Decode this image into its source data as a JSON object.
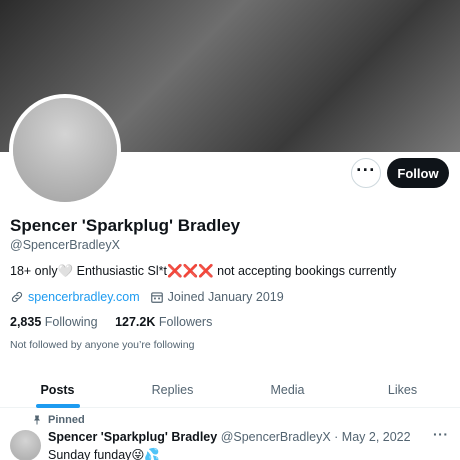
{
  "profile": {
    "display_name": "Spencer 'Sparkplug' Bradley",
    "handle": "@SpencerBradleyX",
    "bio": "18+ only🤍 Enthusiastic Sl*t❌❌❌ not accepting bookings currently",
    "website": "spencerbradley.com",
    "joined": "Joined January 2019",
    "following_count": "2,835",
    "following_label": "Following",
    "followers_count": "127.2K",
    "followers_label": "Followers",
    "not_followed_text": "Not followed by anyone you’re following"
  },
  "actions": {
    "more_label": "···",
    "follow_label": "Follow"
  },
  "tabs": [
    {
      "label": "Posts",
      "active": true
    },
    {
      "label": "Replies",
      "active": false
    },
    {
      "label": "Media",
      "active": false
    },
    {
      "label": "Likes",
      "active": false
    }
  ],
  "pinned_post": {
    "pinned_label": "Pinned",
    "author_name": "Spencer 'Sparkplug' Bradley",
    "author_handle": "@SpencerBradleyX",
    "separator": "·",
    "date": "May 2, 2022",
    "text": "Sunday funday😜💦",
    "more_label": "···"
  },
  "icons": {
    "website": "link-icon",
    "joined": "calendar-icon",
    "pinned": "pin-icon",
    "more": "more-horizontal-icon"
  },
  "colors": {
    "accent": "#1d9bf0",
    "text": "#0f1419",
    "secondary_text": "#536471",
    "follow_button": "#0f1419"
  }
}
